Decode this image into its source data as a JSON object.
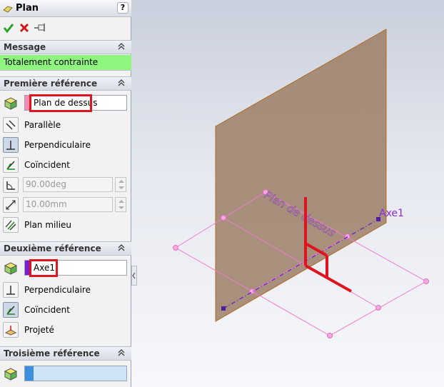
{
  "window": {
    "title": "Plan",
    "help": "?"
  },
  "toolbar": {
    "ok_icon": "checkmark-icon",
    "cancel_icon": "x-icon",
    "pin_icon": "pushpin-icon"
  },
  "message": {
    "header": "Message",
    "text": "Totalement contrainte",
    "bg": "#8ef57e"
  },
  "first_ref": {
    "header": "Première référence",
    "selection": "Plan de dessus",
    "selection_color": "#f48ab4",
    "options": {
      "parallel": "Parallèle",
      "perpendicular": "Perpendiculaire",
      "coincident": "Coïncident",
      "angle": "90.00deg",
      "distance": "10.00mm",
      "mid_plane": "Plan milieu"
    }
  },
  "second_ref": {
    "header": "Deuxième référence",
    "selection": "Axe1",
    "selection_color": "#7a1fd0",
    "options": {
      "perpendicular": "Perpendiculaire",
      "coincident": "Coïncident",
      "projected": "Projeté"
    }
  },
  "third_ref": {
    "header": "Troisième référence",
    "selection": ""
  },
  "graphics": {
    "plane_label": "Plan de dessus",
    "axis_label": "Axe1",
    "plane_color": "#f27bd0",
    "axis_color": "#6b20c8",
    "new_plane_color": "#9c7f66"
  }
}
